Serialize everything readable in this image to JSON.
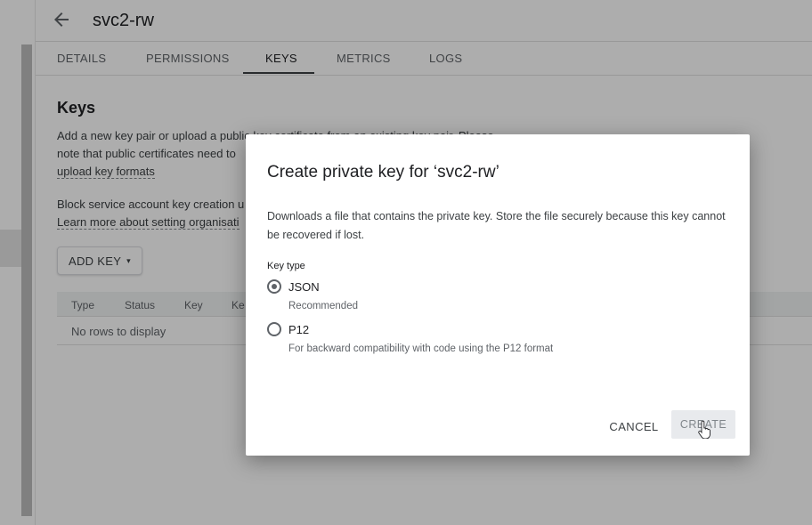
{
  "header": {
    "title": "svc2-rw",
    "back_icon": "arrow-left-icon"
  },
  "tabs": [
    {
      "label": "DETAILS"
    },
    {
      "label": "PERMISSIONS"
    },
    {
      "label": "KEYS",
      "active": true
    },
    {
      "label": "METRICS"
    },
    {
      "label": "LOGS"
    }
  ],
  "keys_section": {
    "heading": "Keys",
    "intro_line1": "Add a new key pair or upload a public key certificate from an existing key pair. Please",
    "intro_line2": "note that public certificates need to",
    "formats_link": "upload key formats",
    "block_line": "Block service account key creation u",
    "learn_more_link": "Learn more about setting organisati",
    "add_key_label": "ADD KEY",
    "add_key_caret": "▾",
    "table_columns": [
      "Type",
      "Status",
      "Key",
      "Ke"
    ],
    "empty_text": "No rows to display"
  },
  "dialog": {
    "title": "Create private key for ‘svc2-rw’",
    "description": "Downloads a file that contains the private key. Store the file securely because this key cannot be recovered if lost.",
    "key_type_label": "Key type",
    "options": [
      {
        "label": "JSON",
        "hint": "Recommended",
        "selected": true
      },
      {
        "label": "P12",
        "hint": "For backward compatibility with code using the P12 format",
        "selected": false
      }
    ],
    "cancel_label": "CANCEL",
    "create_label": "CREATE"
  },
  "colors": {
    "text_primary": "#202124",
    "text_secondary": "#5f6368",
    "scrim": "rgba(0,0,0,0.32)",
    "create_button_bg": "#e8eaed"
  }
}
